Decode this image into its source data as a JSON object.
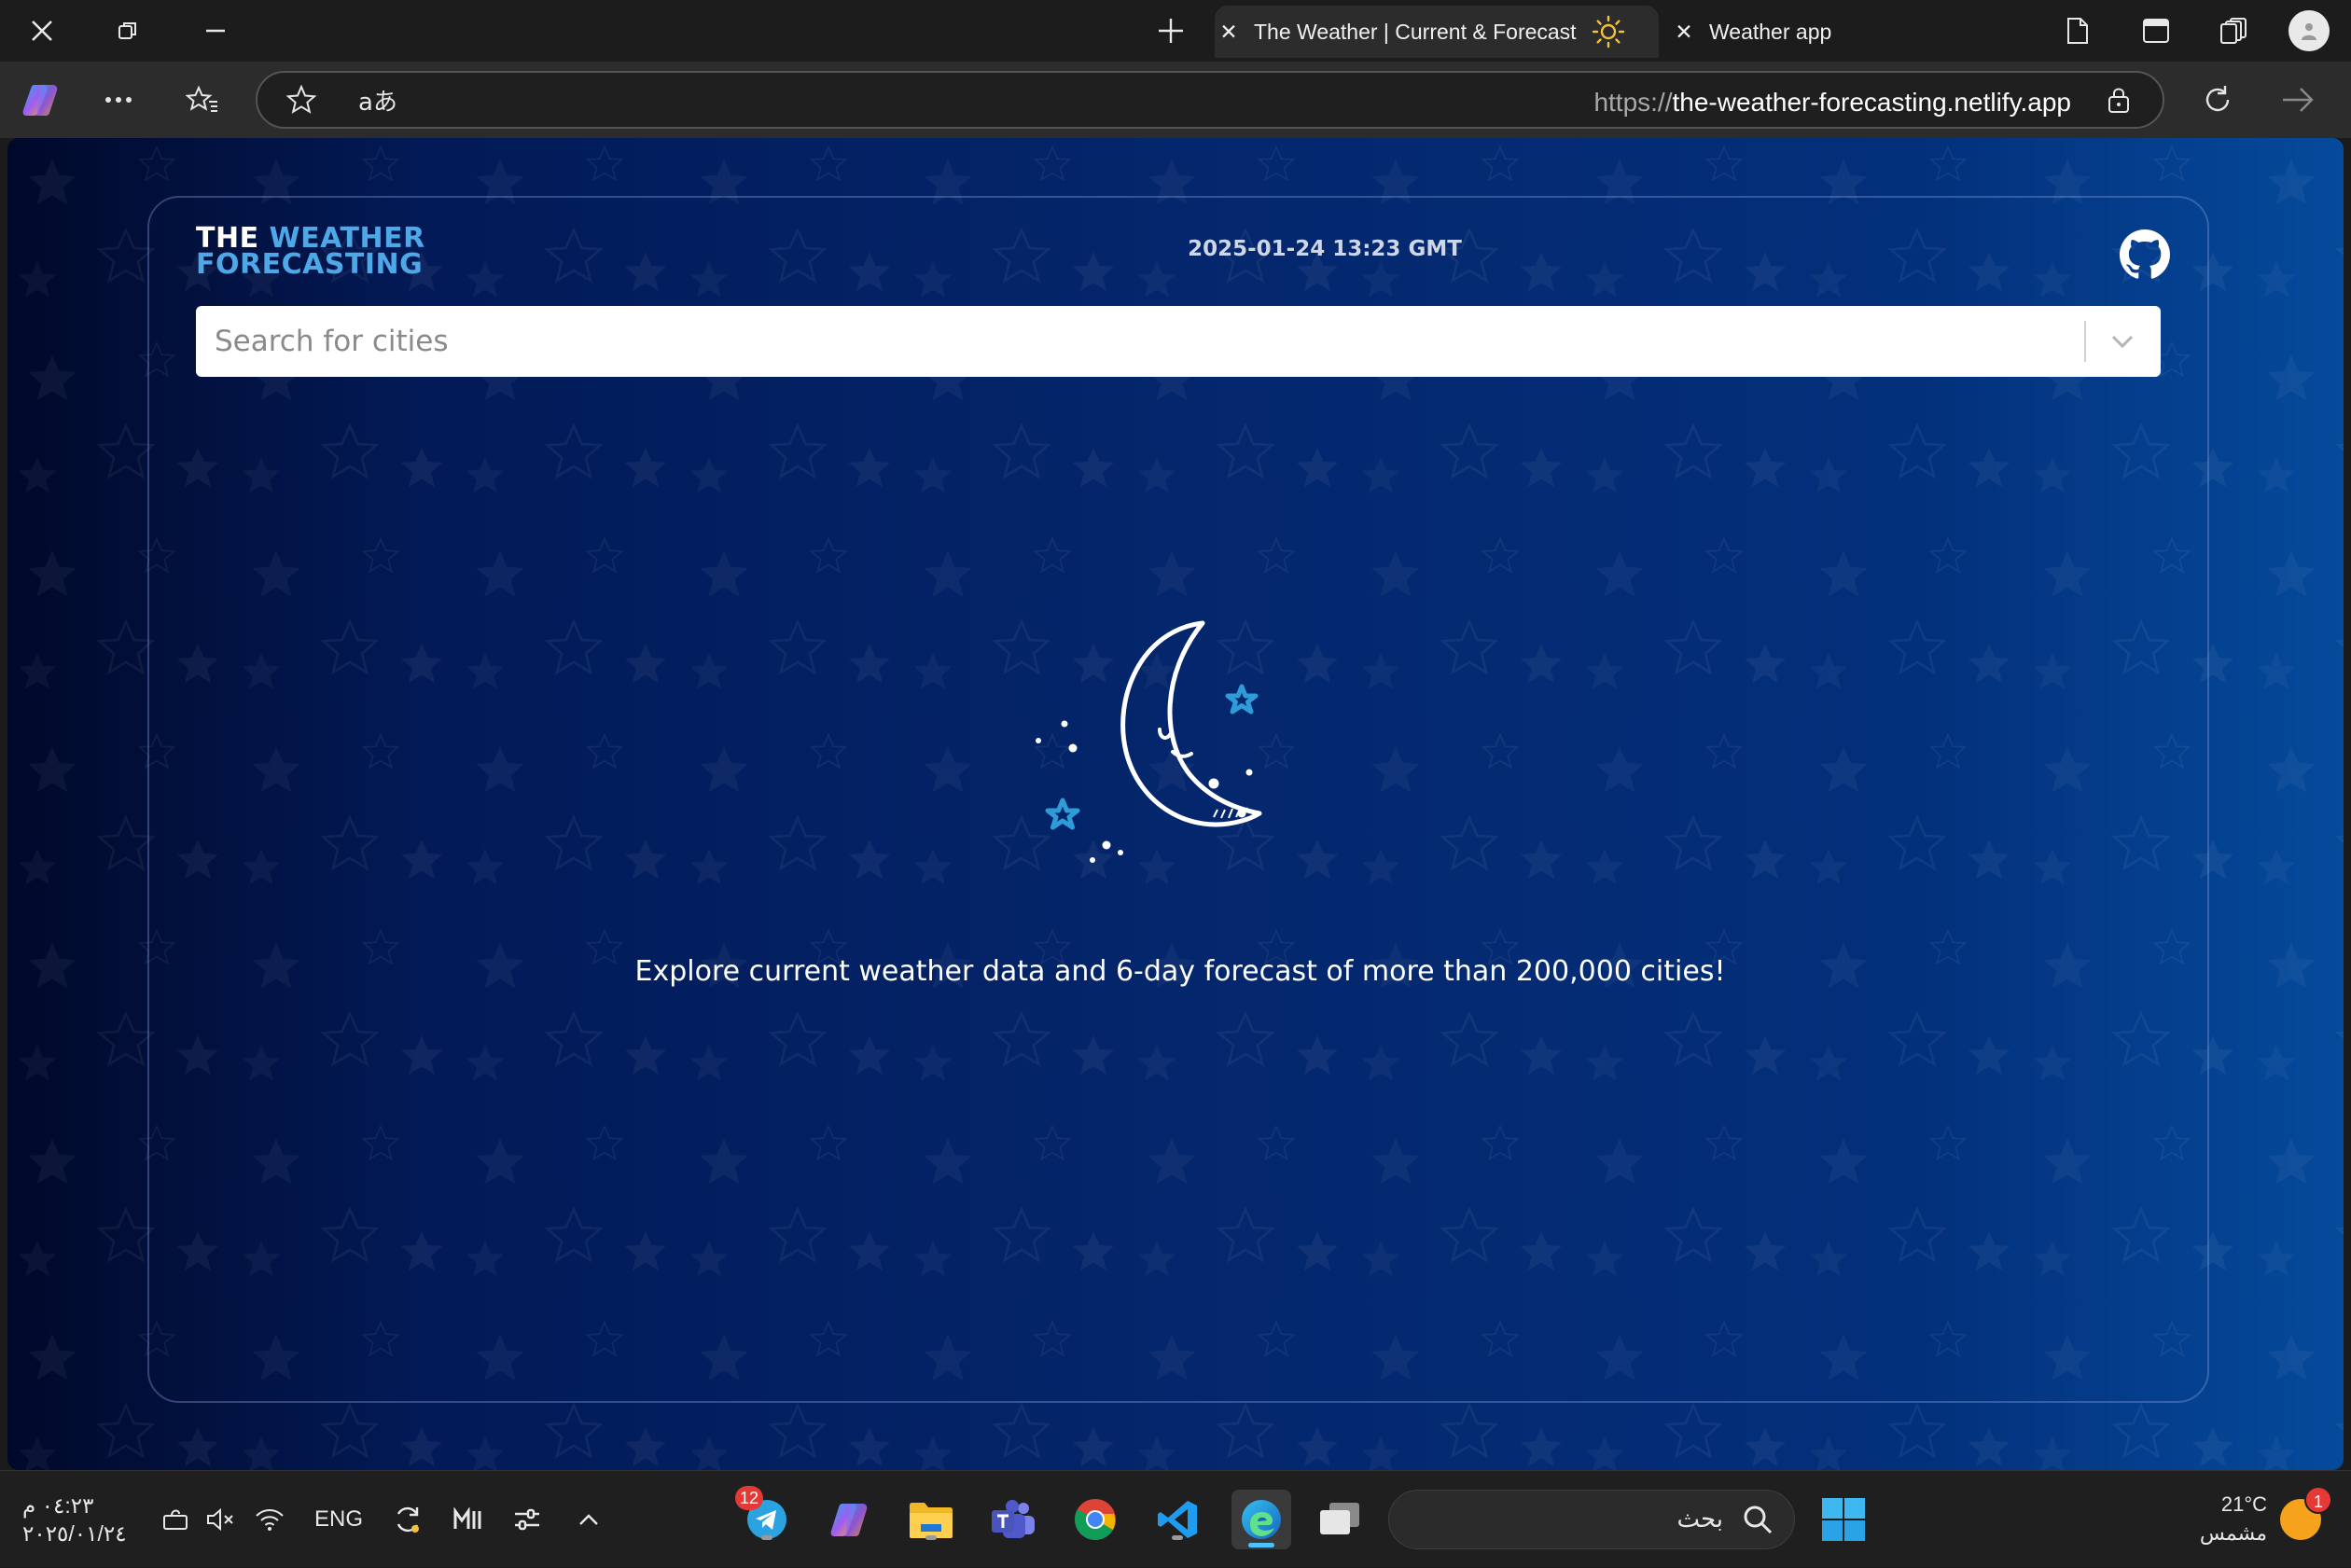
{
  "browser": {
    "tabs": [
      {
        "title": "The Weather | Current & Forecast",
        "active": true,
        "favicon": "sun-icon"
      },
      {
        "title": "Weather app",
        "active": false
      }
    ],
    "address": {
      "scheme": "https://",
      "host": "the-weather-forecasting.netlify.app"
    },
    "reading_mode_label": "aあ"
  },
  "page": {
    "logo": {
      "line1_a": "THE",
      "line1_b": "WEATHER",
      "line2_a": "FORECASTING"
    },
    "datetime": "2025-01-24 13:23 GMT",
    "search": {
      "placeholder": "Search for cities"
    },
    "tagline": "Explore current weather data and 6-day forecast of more than 200,000 cities!",
    "colors": {
      "accent": "#4ea8e8",
      "star": "#2f8fd0",
      "bg_dark": "#01092a",
      "bg_light": "#054a9b"
    }
  },
  "taskbar": {
    "time": "٠٤:٢٣ م",
    "date": "٢٠٢٥/٠١/٢٤",
    "language": "ENG",
    "search_placeholder": "بحث",
    "telegram_badge": "12",
    "weather": {
      "temp": "21°C",
      "condition": "مشمس",
      "badge": "1"
    }
  }
}
